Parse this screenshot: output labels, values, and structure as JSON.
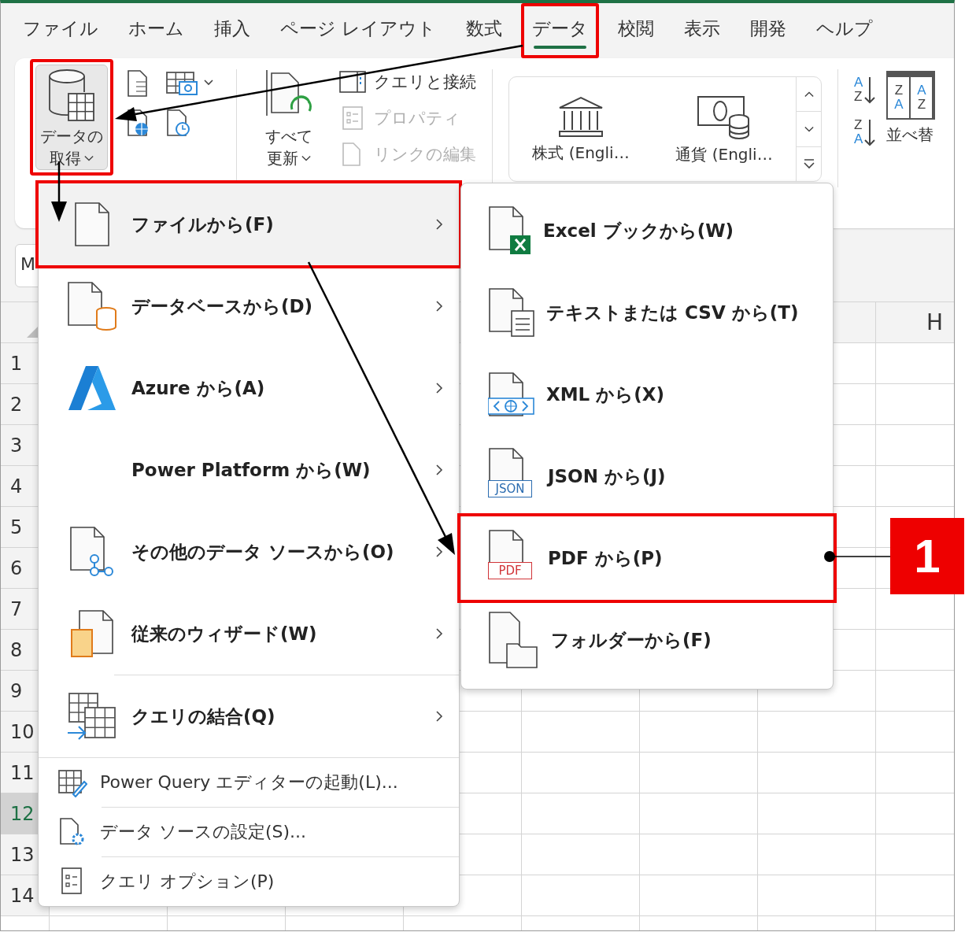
{
  "tabs": [
    {
      "label": "ファイル",
      "selected": false,
      "highlighted": false
    },
    {
      "label": "ホーム",
      "selected": false,
      "highlighted": false
    },
    {
      "label": "挿入",
      "selected": false,
      "highlighted": false
    },
    {
      "label": "ページ レイアウト",
      "selected": false,
      "highlighted": false
    },
    {
      "label": "数式",
      "selected": false,
      "highlighted": false
    },
    {
      "label": "データ",
      "selected": true,
      "highlighted": true
    },
    {
      "label": "校閲",
      "selected": false,
      "highlighted": false
    },
    {
      "label": "表示",
      "selected": false,
      "highlighted": false
    },
    {
      "label": "開発",
      "selected": false,
      "highlighted": false
    },
    {
      "label": "ヘルプ",
      "selected": false,
      "highlighted": false
    }
  ],
  "ribbon": {
    "get_data": {
      "lines": [
        "データの",
        "取得"
      ],
      "highlighted": true
    },
    "refresh_all": {
      "lines": [
        "すべて",
        "更新"
      ]
    },
    "query_items": [
      {
        "label": "クエリと接続",
        "disabled": false
      },
      {
        "label": "プロパティ",
        "disabled": true
      },
      {
        "label": "リンクの編集",
        "disabled": true
      }
    ],
    "data_types": [
      {
        "label": "株式 (Engli…"
      },
      {
        "label": "通貨 (Engli…"
      }
    ],
    "sort_buttons": [
      {
        "letters": [
          "A",
          "Z"
        ]
      },
      {
        "letters": [
          "Z",
          "A"
        ]
      }
    ],
    "sort_table_letters": [
      [
        "Z",
        "A"
      ],
      [
        "A",
        "Z"
      ]
    ],
    "sort_label": "並べ替"
  },
  "name_box": {
    "value": "M"
  },
  "sheet": {
    "column_headers": [
      "H"
    ],
    "rows": [
      {
        "label": "1",
        "selected": false
      },
      {
        "label": "2",
        "selected": false
      },
      {
        "label": "3",
        "selected": false
      },
      {
        "label": "4",
        "selected": false
      },
      {
        "label": "5",
        "selected": false
      },
      {
        "label": "6",
        "selected": false
      },
      {
        "label": "7",
        "selected": false
      },
      {
        "label": "8",
        "selected": false
      },
      {
        "label": "9",
        "selected": false
      },
      {
        "label": "10",
        "selected": false
      },
      {
        "label": "11",
        "selected": false
      },
      {
        "label": "12",
        "selected": true
      },
      {
        "label": "13",
        "selected": false
      },
      {
        "label": "14",
        "selected": false
      }
    ]
  },
  "menu": {
    "items": [
      {
        "kind": "large",
        "label": "ファイルから(F)",
        "submenu": true,
        "expanded": true,
        "highlighted": true
      },
      {
        "kind": "large",
        "label": "データベースから(D)",
        "submenu": true,
        "expanded": false,
        "highlighted": false
      },
      {
        "kind": "large",
        "label": "Azure から(A)",
        "submenu": true,
        "expanded": false,
        "highlighted": false
      },
      {
        "kind": "large",
        "label": "Power Platform から(W)",
        "submenu": true,
        "expanded": false,
        "highlighted": false
      },
      {
        "kind": "large",
        "label": "その他のデータ ソースから(O)",
        "submenu": true,
        "expanded": false,
        "highlighted": false
      },
      {
        "kind": "large",
        "label": "従来のウィザード(W)",
        "submenu": true,
        "expanded": false,
        "highlighted": false
      },
      {
        "kind": "large",
        "label": "クエリの結合(Q)",
        "submenu": true,
        "expanded": false,
        "highlighted": false
      },
      {
        "kind": "small",
        "label": "Power Query エディターの起動(L)..."
      },
      {
        "kind": "small",
        "label": "データ ソースの設定(S)..."
      },
      {
        "kind": "small",
        "label": "クエリ オプション(P)"
      }
    ]
  },
  "submenu": {
    "items": [
      {
        "label": "Excel ブックから(W)",
        "highlighted": false
      },
      {
        "label": "テキストまたは CSV から(T)",
        "highlighted": false
      },
      {
        "label": "XML から(X)",
        "highlighted": false
      },
      {
        "label": "JSON から(J)",
        "icon_text": "JSON",
        "highlighted": false
      },
      {
        "label": "PDF から(P)",
        "icon_text": "PDF",
        "highlighted": true
      },
      {
        "label": "フォルダーから(F)",
        "highlighted": false
      }
    ]
  },
  "callout": {
    "number": "1"
  }
}
